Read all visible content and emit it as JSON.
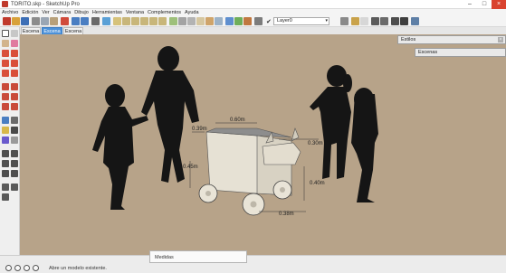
{
  "window": {
    "title": "TORITO.skp - SketchUp Pro",
    "minimize_glyph": "–",
    "maximize_glyph": "□",
    "close_glyph": "×"
  },
  "menu": [
    "Archivo",
    "Edición",
    "Ver",
    "Cámara",
    "Dibujo",
    "Herramientas",
    "Ventana",
    "Complementos",
    "Ayuda"
  ],
  "toolbar": {
    "layer_check": "✔",
    "layer_value": "Layer0",
    "layer_chevron": "▾"
  },
  "scenes": [
    {
      "label": "Escena 1",
      "active": false
    },
    {
      "label": "Escena 2",
      "active": true
    },
    {
      "label": "Escena 3",
      "active": false
    }
  ],
  "trays": {
    "estilos": "Estilos",
    "escenas": "Escenas",
    "close_glyph": "×"
  },
  "model": {
    "dimensions": [
      "0.60m",
      "0.39m",
      "0.30m",
      "0.45m",
      "0.40m",
      "0.38m"
    ]
  },
  "status": {
    "measurements_label": "Medidas",
    "message": "Abre un modelo existente."
  },
  "colors": {
    "background": "#b9a48a",
    "active_tab": "#4a90d9",
    "close_button": "#d9432f",
    "silhouette": "#151515",
    "model_fill": "#e6e1d4"
  }
}
